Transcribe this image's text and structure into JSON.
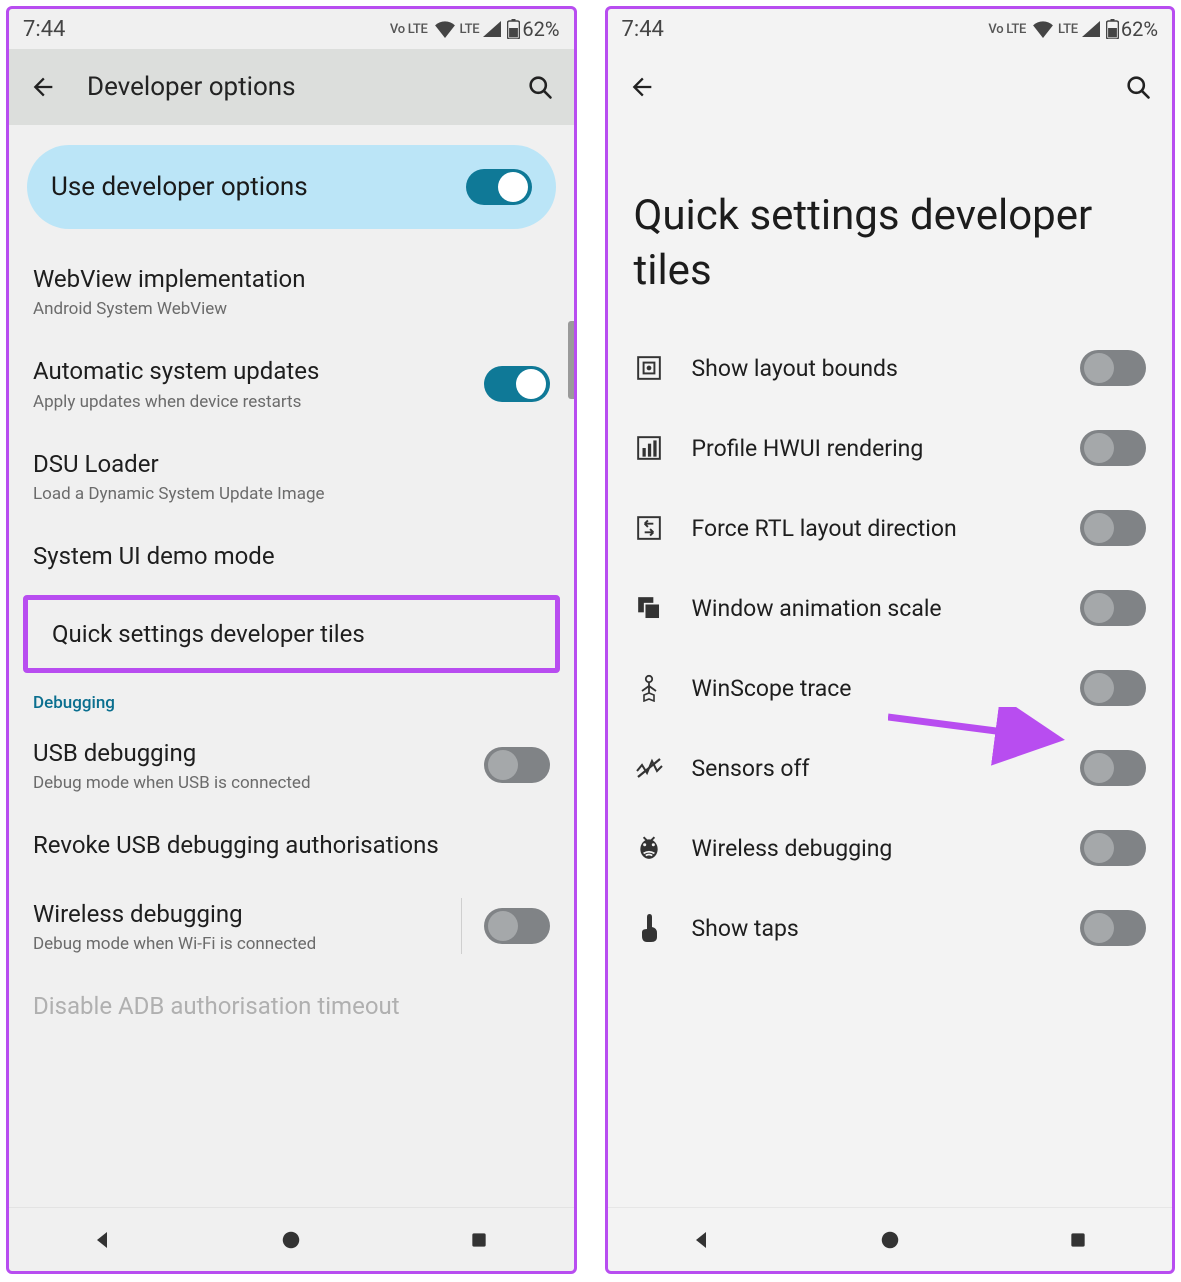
{
  "status": {
    "time": "7:44",
    "volte": "Vo LTE",
    "lte": "LTE",
    "battery_pct": "62%"
  },
  "left": {
    "appbar_title": "Developer options",
    "master": {
      "label": "Use developer options",
      "on": true
    },
    "items": [
      {
        "title": "WebView implementation",
        "subtitle": "Android System WebView"
      },
      {
        "title": "Automatic system updates",
        "subtitle": "Apply updates when device restarts",
        "toggle": true,
        "on": true
      },
      {
        "title": "DSU Loader",
        "subtitle": "Load a Dynamic System Update Image"
      },
      {
        "title": "System UI demo mode"
      },
      {
        "title": "Quick settings developer tiles",
        "highlighted": true
      }
    ],
    "section": "Debugging",
    "debug_items": [
      {
        "title": "USB debugging",
        "subtitle": "Debug mode when USB is connected",
        "toggle": true,
        "on": false
      },
      {
        "title": "Revoke USB debugging authorisations"
      },
      {
        "title": "Wireless debugging",
        "subtitle": "Debug mode when Wi-Fi is connected",
        "toggle": true,
        "on": false,
        "divided": true
      },
      {
        "title": "Disable ADB authorisation timeout",
        "faded": true
      }
    ]
  },
  "right": {
    "bigtitle": "Quick settings developer tiles",
    "tiles": [
      {
        "icon": "layout-bounds-icon",
        "label": "Show layout bounds",
        "on": false
      },
      {
        "icon": "profile-hwui-icon",
        "label": "Profile HWUI rendering",
        "on": false
      },
      {
        "icon": "rtl-icon",
        "label": "Force RTL layout direction",
        "on": false
      },
      {
        "icon": "window-anim-icon",
        "label": "Window animation scale",
        "on": false
      },
      {
        "icon": "winscope-icon",
        "label": "WinScope trace",
        "on": false
      },
      {
        "icon": "sensors-off-icon",
        "label": "Sensors off",
        "on": false,
        "pointed": true
      },
      {
        "icon": "wireless-debug-icon",
        "label": "Wireless debugging",
        "on": false
      },
      {
        "icon": "show-taps-icon",
        "label": "Show taps",
        "on": false
      }
    ]
  }
}
